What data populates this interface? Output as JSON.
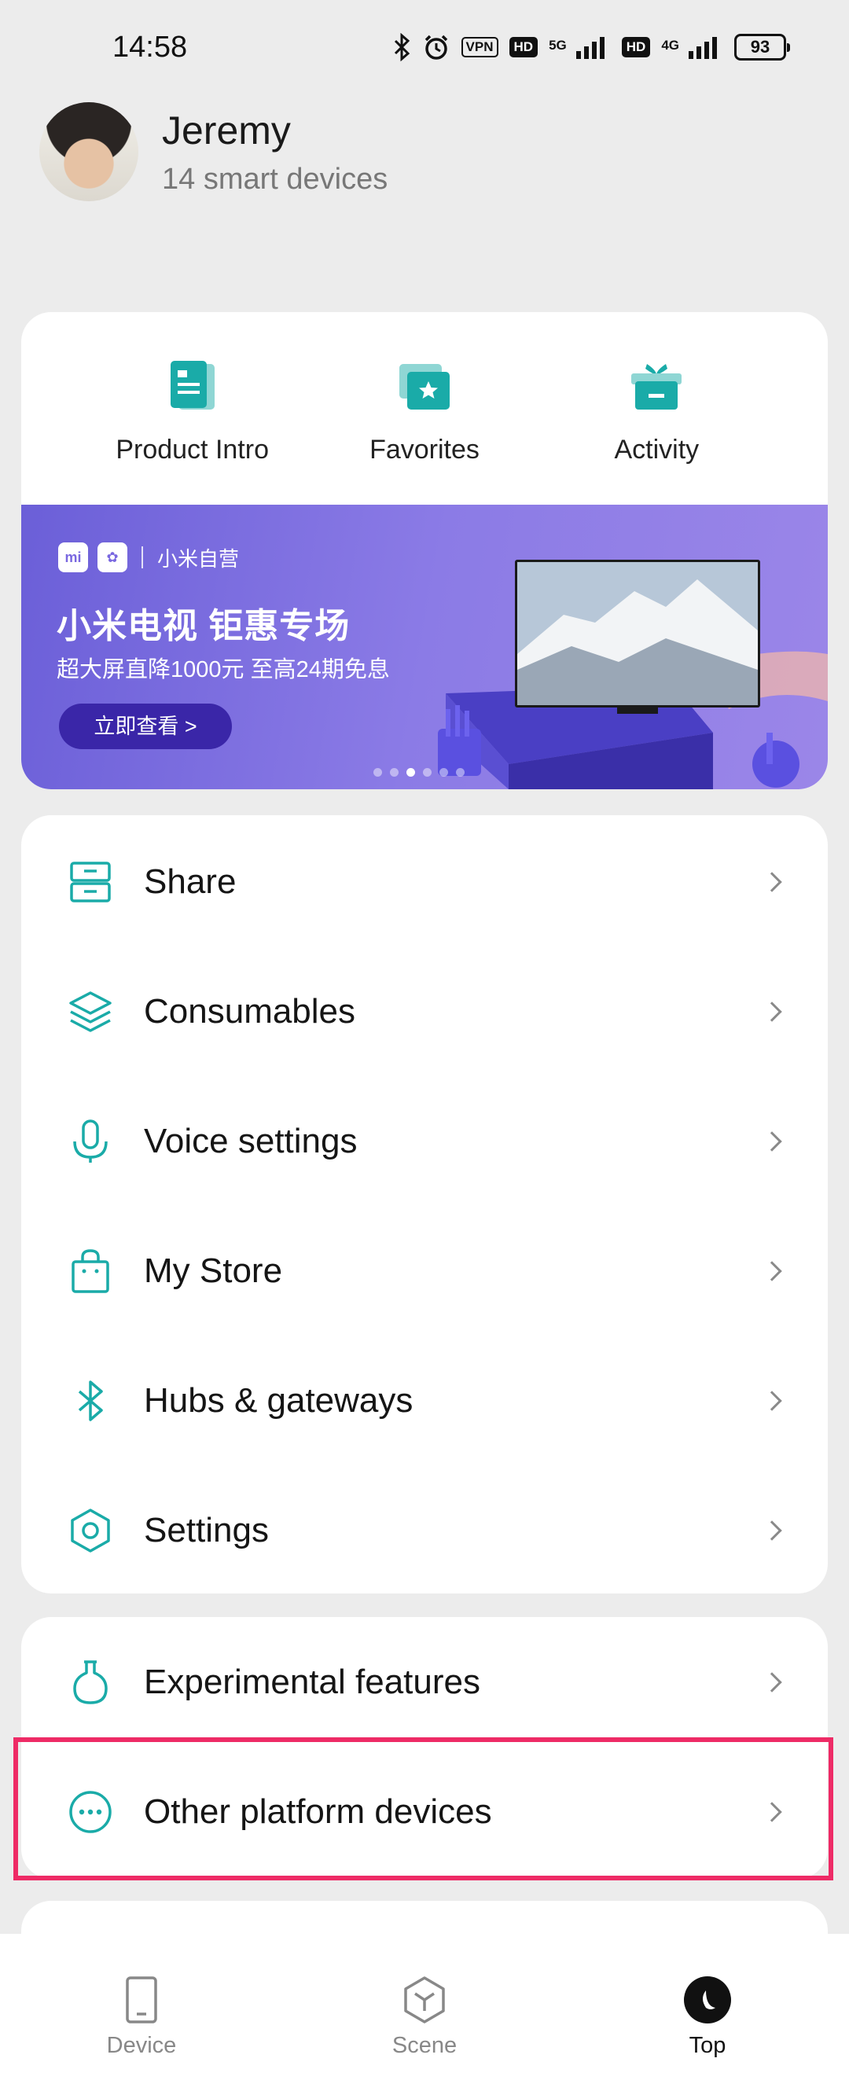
{
  "status_bar": {
    "time": "14:58",
    "vpn": "VPN",
    "hd": "HD",
    "net_5g": "5G",
    "net_4g": "4G",
    "battery": "93"
  },
  "profile": {
    "name": "Jeremy",
    "subtitle": "14 smart devices"
  },
  "quick_actions": [
    {
      "label": "Product Intro",
      "icon": "document-icon"
    },
    {
      "label": "Favorites",
      "icon": "star-icon"
    },
    {
      "label": "Activity",
      "icon": "gift-icon"
    }
  ],
  "banner": {
    "logo_mi": "mi",
    "brand": "小米自营",
    "title": "小米电视 钜惠专场",
    "subtitle": "超大屏直降1000元 至高24期免息",
    "button": "立即查看 >",
    "page_count": 6,
    "active_page": 2
  },
  "menu_main": [
    {
      "label": "Share",
      "icon": "share-box-icon"
    },
    {
      "label": "Consumables",
      "icon": "layers-icon"
    },
    {
      "label": "Voice settings",
      "icon": "microphone-icon"
    },
    {
      "label": "My Store",
      "icon": "shopping-bag-icon"
    },
    {
      "label": "Hubs & gateways",
      "icon": "bluetooth-icon"
    },
    {
      "label": "Settings",
      "icon": "hexagon-gear-icon"
    }
  ],
  "menu_extra": [
    {
      "label": "Experimental features",
      "icon": "flask-icon"
    },
    {
      "label": "Other platform devices",
      "icon": "more-circle-icon"
    }
  ],
  "bottom_nav": [
    {
      "label": "Device",
      "icon": "tablet-icon",
      "active": false
    },
    {
      "label": "Scene",
      "icon": "cube-icon",
      "active": false
    },
    {
      "label": "Top",
      "icon": "moon-icon",
      "active": true
    }
  ],
  "colors": {
    "accent": "#1aaba8",
    "highlight": "#ee2b66",
    "banner": "#7b6ce2"
  }
}
